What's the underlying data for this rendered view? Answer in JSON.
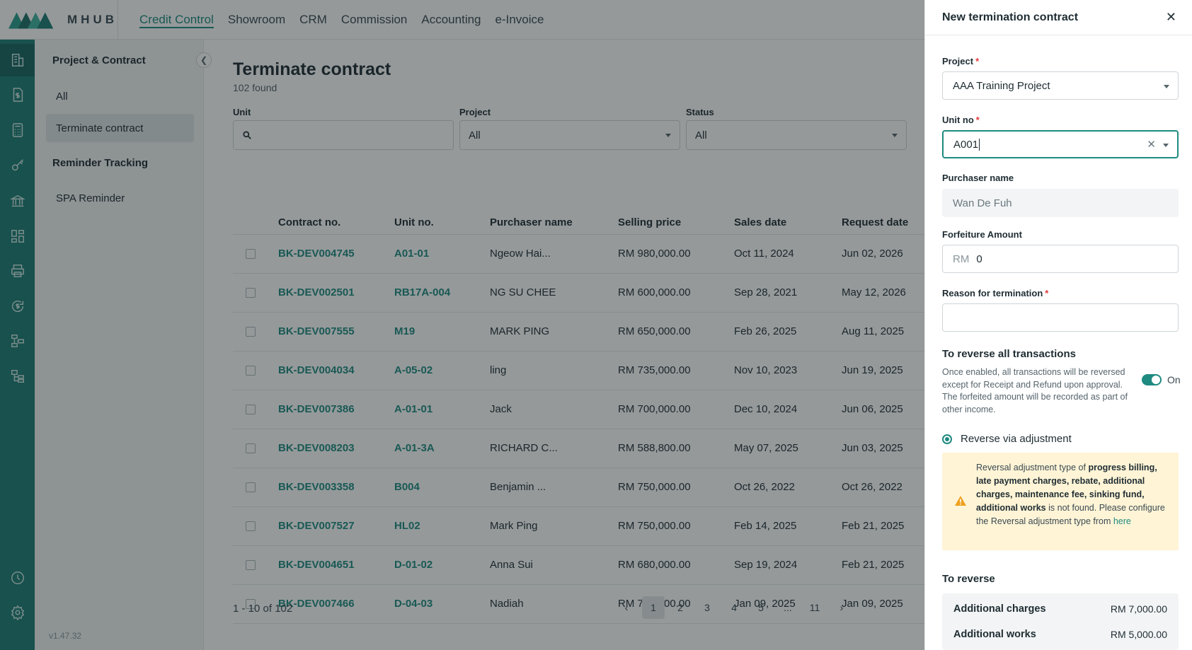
{
  "topnav": {
    "logo_text": "MHUB",
    "items": [
      "Credit Control",
      "Showroom",
      "CRM",
      "Commission",
      "Accounting",
      "e-Invoice"
    ],
    "active": "Credit Control"
  },
  "rail": {
    "icons": [
      "building-document-icon",
      "invoice-dollar-icon",
      "calculator-icon",
      "key-icon",
      "bank-icon",
      "dashboard-grid-icon",
      "printer-icon",
      "dollar-refresh-icon",
      "workflow-icon",
      "org-chart-icon",
      "history-clock-icon",
      "settings-gear-icon"
    ]
  },
  "sidebar": {
    "group1": "Project & Contract",
    "items1": [
      "All",
      "Terminate contract"
    ],
    "group2": "Reminder Tracking",
    "items2": [
      "SPA Reminder"
    ],
    "version": "v1.47.32"
  },
  "main": {
    "title": "Terminate contract",
    "found": "102 found",
    "filters": {
      "unit_label": "Unit",
      "project_label": "Project",
      "project_value": "All",
      "status_label": "Status",
      "status_value": "All"
    },
    "columns": [
      "Contract no.",
      "Unit no.",
      "Purchaser name",
      "Selling price",
      "Sales date",
      "Request date"
    ],
    "rows": [
      {
        "contract": "BK-DEV004745",
        "unit": "A01-01",
        "purchaser": "Ngeow Hai...",
        "price": "RM 980,000.00",
        "sales": "Oct 11, 2024",
        "request": "Jun 02, 2026"
      },
      {
        "contract": "BK-DEV002501",
        "unit": "RB17A-004",
        "purchaser": "NG SU CHEE",
        "price": "RM 600,000.00",
        "sales": "Sep 28, 2021",
        "request": "May 12, 2026"
      },
      {
        "contract": "BK-DEV007555",
        "unit": "M19",
        "purchaser": "MARK PING",
        "price": "RM 650,000.00",
        "sales": "Feb 26, 2025",
        "request": "Aug 11, 2025"
      },
      {
        "contract": "BK-DEV004034",
        "unit": "A-05-02",
        "purchaser": "ling",
        "price": "RM 735,000.00",
        "sales": "Nov 10, 2023",
        "request": "Jun 19, 2025"
      },
      {
        "contract": "BK-DEV007386",
        "unit": "A-01-01",
        "purchaser": "Jack",
        "price": "RM 700,000.00",
        "sales": "Dec 10, 2024",
        "request": "Jun 06, 2025"
      },
      {
        "contract": "BK-DEV008203",
        "unit": "A-01-3A",
        "purchaser": "RICHARD C...",
        "price": "RM 588,800.00",
        "sales": "May 07, 2025",
        "request": "Jun 03, 2025"
      },
      {
        "contract": "BK-DEV003358",
        "unit": "B004",
        "purchaser": "Benjamin ...",
        "price": "RM 750,000.00",
        "sales": "Oct 26, 2022",
        "request": "Oct 26, 2022"
      },
      {
        "contract": "BK-DEV007527",
        "unit": "HL02",
        "purchaser": "Mark Ping",
        "price": "RM 750,000.00",
        "sales": "Feb 14, 2025",
        "request": "Feb 21, 2025"
      },
      {
        "contract": "BK-DEV004651",
        "unit": "D-01-02",
        "purchaser": "Anna Sui",
        "price": "RM 680,000.00",
        "sales": "Sep 19, 2024",
        "request": "Feb 21, 2025"
      },
      {
        "contract": "BK-DEV007466",
        "unit": "D-04-03",
        "purchaser": "Nadiah",
        "price": "RM 735,000.00",
        "sales": "Jan 09, 2025",
        "request": "Jan 09, 2025"
      }
    ],
    "pagination": {
      "summary": "1 - 10 of 102",
      "pages": [
        "1",
        "2",
        "3",
        "4",
        "5",
        "...",
        "11"
      ],
      "current": "1"
    }
  },
  "drawer": {
    "title": "New termination contract",
    "project_label": "Project",
    "project_value": "AAA Training Project",
    "unit_label": "Unit no",
    "unit_value": "A001",
    "purchaser_label": "Purchaser name",
    "purchaser_value": "Wan De Fuh",
    "forfeiture_label": "Forfeiture Amount",
    "forfeiture_prefix": "RM",
    "forfeiture_value": "0",
    "reason_label": "Reason for termination",
    "reason_value": "",
    "reverse_title": "To reverse all transactions",
    "reverse_desc": "Once enabled, all transactions will be reversed except for Receipt and Refund upon approval. The forfeited amount will be recorded as part of other income.",
    "toggle_label": "On",
    "radio_label": "Reverse via adjustment",
    "warning": {
      "prefix": "Reversal adjustment type of",
      "bold": "progress billing, late payment charges, rebate, additional charges, maintenance fee, sinking fund, additional works",
      "suffix": "is not found. Please configure the Reversal adjustment type from",
      "link": "here"
    },
    "to_reverse_title": "To reverse",
    "to_reverse_items": [
      {
        "label": "Additional charges",
        "amount": "RM 7,000.00"
      },
      {
        "label": "Additional works",
        "amount": "RM 5,000.00"
      }
    ]
  },
  "colors": {
    "accent": "#1e8a80",
    "rail": "#1d7c74",
    "warning_bg": "#fff4d6",
    "required": "#e23a3a"
  }
}
